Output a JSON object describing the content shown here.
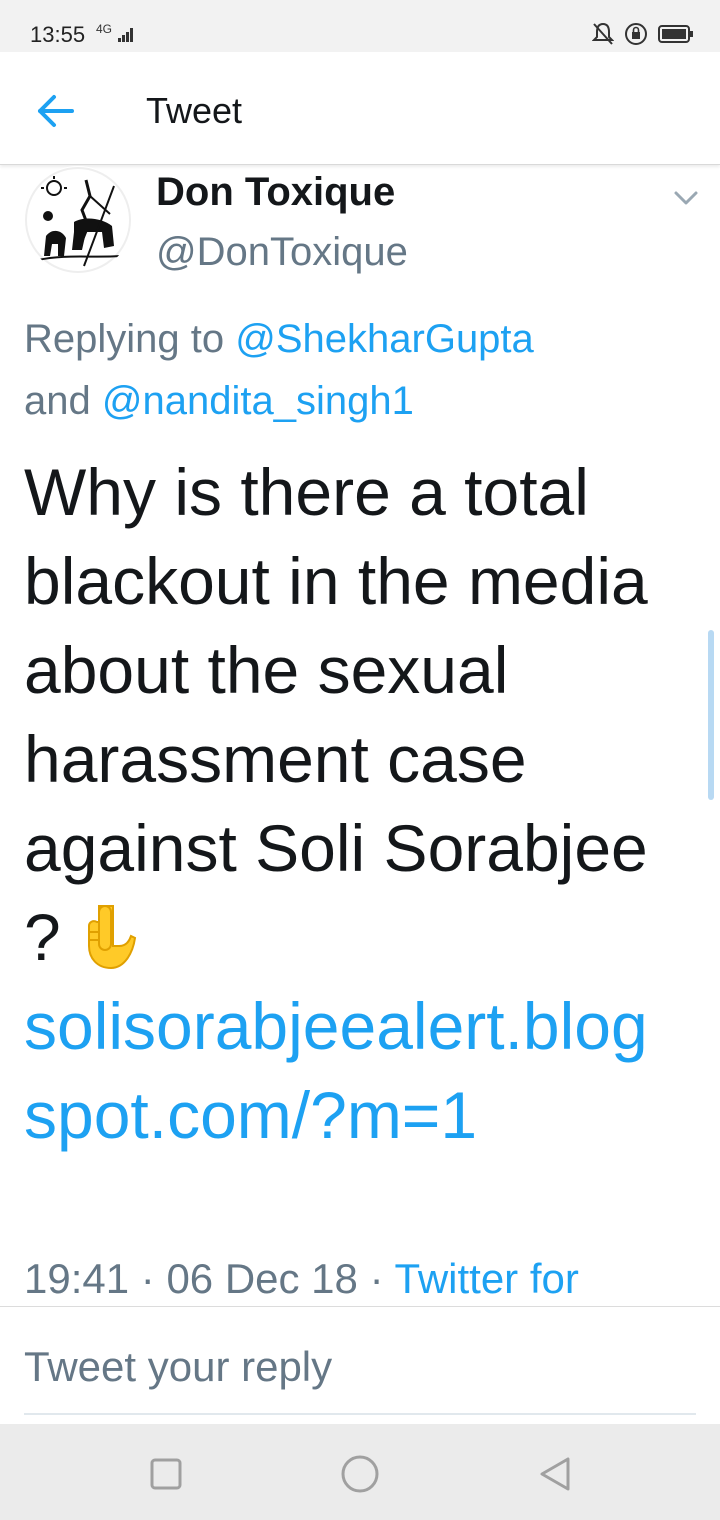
{
  "status_bar": {
    "time": "13:55",
    "network": "4G",
    "icons": [
      "signal-bars-icon",
      "mute-bell-icon",
      "rotation-lock-icon",
      "battery-icon"
    ]
  },
  "app_bar": {
    "title": "Tweet",
    "back_icon": "arrow-left-icon"
  },
  "tweet": {
    "author_name": "Don Toxique",
    "author_handle": "@DonToxique",
    "replying_prefix": "Replying to ",
    "replying_mention_1": "@ShekharGupta",
    "replying_joiner": "and ",
    "replying_mention_2": "@nandita_singh1",
    "text": "Why is there a total blackout in the media about the sexual harassment case against Soli Sorabjee ? ",
    "emoji": "backhand-index-pointing-down",
    "link": "solisorabjeealert.blogspot.com/?m=1",
    "time": "19:41",
    "separator": " · ",
    "date": "06 Dec 18",
    "source": "Twitter for"
  },
  "reply": {
    "placeholder": "Tweet your reply"
  },
  "nav": {
    "buttons": [
      "recents-square-icon",
      "home-circle-icon",
      "back-triangle-icon"
    ]
  },
  "colors": {
    "accent": "#1da1f2",
    "secondary_text": "#657786",
    "primary_text": "#14171a"
  }
}
